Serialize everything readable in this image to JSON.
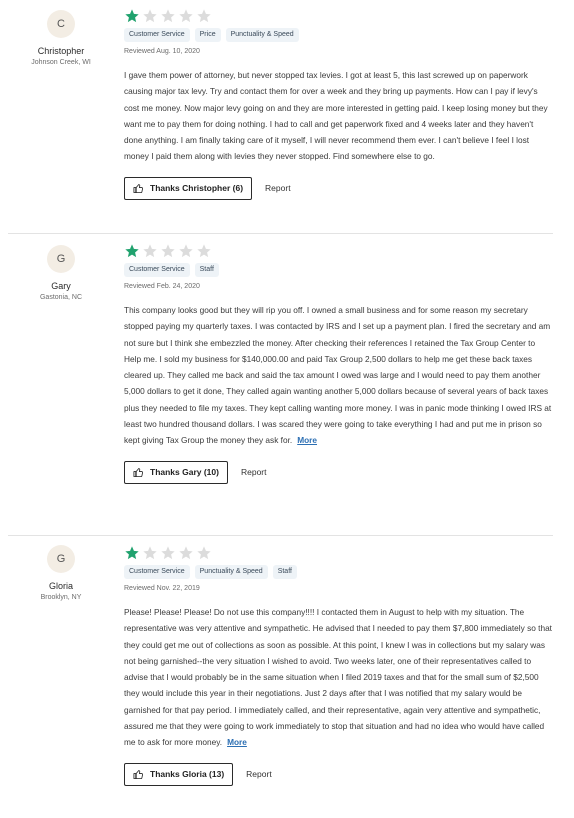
{
  "colors": {
    "star_filled": "#20a26e",
    "star_empty": "#dcdcdc",
    "tag_bg": "#eef3f7",
    "link": "#2c6fb3"
  },
  "icons": {
    "rating": "star-icon",
    "thanks": "thumbs-up-icon"
  },
  "reviews": [
    {
      "initial": "C",
      "name": "Christopher",
      "location": "Johnson Creek, WI",
      "rating": 1,
      "tags": [
        "Customer Service",
        "Price",
        "Punctuality & Speed"
      ],
      "date": "Reviewed Aug. 10, 2020",
      "text": "I gave them power of attorney, but never stopped tax levies. I got at least 5, this last screwed up on paperwork causing major tax levy. Try and contact them for over a week and they bring up payments. How can I pay if levy's cost me money. Now major levy going on and they are more interested in getting paid. I keep losing money but they want me to pay them for doing nothing. I had to call and get paperwork fixed and 4 weeks later and they haven't done anything. I am finally taking care of it myself, I will never recommend them ever. I can't believe I feel I lost money I paid them along with levies they never stopped. Find somewhere else to go.",
      "more": "",
      "thanks": "Thanks Christopher (6)",
      "report": "Report"
    },
    {
      "initial": "G",
      "name": "Gary",
      "location": "Gastonia, NC",
      "rating": 1,
      "tags": [
        "Customer Service",
        "Staff"
      ],
      "date": "Reviewed Feb. 24, 2020",
      "text": "This company looks good but they will rip you off. I owned a small business and for some reason my secretary stopped paying my quarterly taxes. I was contacted by IRS and I set up a payment plan. I fired the secretary and am not sure but I think she embezzled the money. After checking their references I retained the Tax Group Center to Help me. I sold my business for $140,000.00 and paid Tax Group 2,500 dollars to help me get these back taxes cleared up. They called me back and said the tax amount I owed was large and I would need to pay them another 5,000 dollars to get it done, They called again wanting another 5,000 dollars because of several years of back taxes plus they needed to file my taxes. They kept calling wanting more money. I was in panic mode thinking I owed IRS at least two hundred thousand dollars. I was scared they were going to take everything I had and put me in prison so kept giving Tax Group the money they ask for.",
      "more": "More",
      "thanks": "Thanks Gary (10)",
      "report": "Report"
    },
    {
      "initial": "G",
      "name": "Gloria",
      "location": "Brooklyn, NY",
      "rating": 1,
      "tags": [
        "Customer Service",
        "Punctuality & Speed",
        "Staff"
      ],
      "date": "Reviewed Nov. 22, 2019",
      "text": "Please! Please! Please! Do not use this company!!!! I contacted them in August to help with my situation. The representative was very attentive and sympathetic. He advised that I needed to pay them $7,800 immediately so that they could get me out of collections as soon as possible. At this point, I knew I was in collections but my salary was not being garnished--the very situation I wished to avoid. Two weeks later, one of their representatives called to advise that I would probably be in the same situation when I filed 2019 taxes and that for the small sum of $2,500 they would include this year in their negotiations. Just 2 days after that I was notified that my salary would be garnished for that pay period. I immediately called, and their representative, again very attentive and sympathetic, assured me that they were going to work immediately to stop that situation and had no idea who would have called me to ask for more money.",
      "more": "More",
      "thanks": "Thanks Gloria (13)",
      "report": "Report"
    }
  ]
}
